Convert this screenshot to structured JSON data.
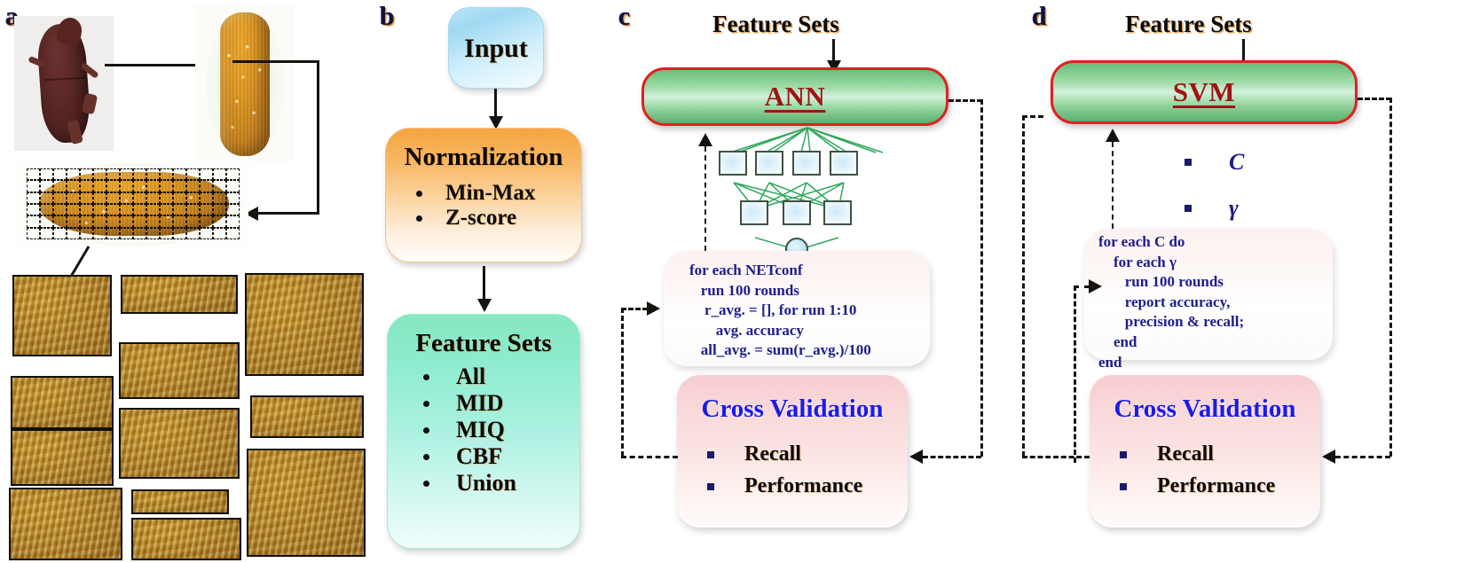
{
  "figure": {
    "panels": [
      {
        "id": "a",
        "letter": "a"
      },
      {
        "id": "b",
        "letter": "b"
      },
      {
        "id": "c",
        "letter": "c"
      },
      {
        "id": "d",
        "letter": "d"
      }
    ]
  },
  "panel_a": {
    "letter": "a",
    "images": {
      "weevil": "rice-weevil-photo",
      "kernel": "rice-kernel-photo",
      "kernel_gridded": "rice-kernel-with-grid-overlay",
      "patches": "texture-patch-samples"
    },
    "grid": {
      "columns": 16,
      "rows": 6
    },
    "patch_count": 12
  },
  "panel_b": {
    "letter": "b",
    "input": {
      "title": "Input"
    },
    "normalization": {
      "title": "Normalization",
      "bullets": [
        "Min-Max",
        "Z-score"
      ]
    },
    "feature_sets": {
      "title": "Feature Sets",
      "bullets": [
        "All",
        "MID",
        "MIQ",
        "CBF",
        "Union"
      ]
    }
  },
  "panel_c": {
    "letter": "c",
    "feature_sets_label": "Feature Sets",
    "classifier": "ANN",
    "network": {
      "hidden_nodes": 4,
      "output_nodes": 3
    },
    "pseudocode": [
      "for each NETconf",
      "   run 100 rounds",
      "    r_avg. = [], for run 1:10",
      "       avg. accuracy",
      "   all_avg. = sum(r_avg.)/100"
    ],
    "cross_validation": {
      "title": "Cross Validation",
      "bullets": [
        "Recall",
        "Performance"
      ]
    }
  },
  "panel_d": {
    "letter": "d",
    "feature_sets_label": "Feature Sets",
    "classifier": "SVM",
    "params": [
      "C",
      "γ"
    ],
    "pseudocode": [
      "for each C do",
      "    for each γ",
      "       run 100 rounds",
      "       report accuracy,",
      "       precision & recall;",
      "    end",
      "end"
    ],
    "cross_validation": {
      "title": "Cross Validation",
      "bullets": [
        "Recall",
        "Performance"
      ]
    }
  },
  "colors": {
    "classifier_border": "#e02020",
    "classifier_label": "#9e1414",
    "cross_validation_title": "#1a1aee",
    "pseudocode_text": "#1d1d8c",
    "input_box": "#9fd9f2",
    "normalization_box": "#f6a440",
    "feature_sets_box": "#85e8c0",
    "cv_box": "#f7cdd0",
    "network_link": "#2ea85c"
  }
}
